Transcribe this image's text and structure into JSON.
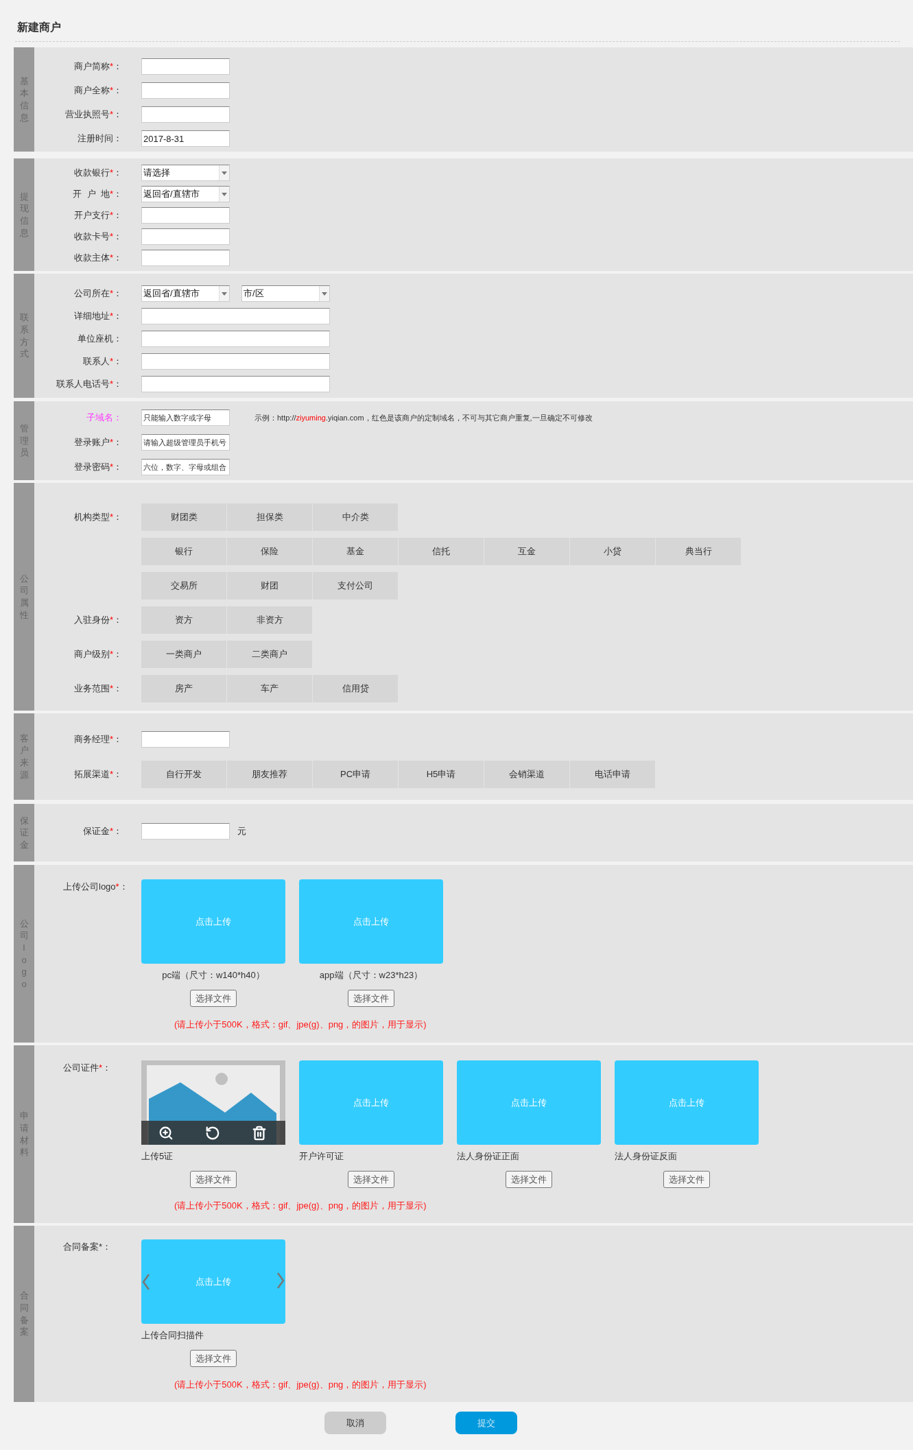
{
  "page": {
    "title": "新建商户"
  },
  "sections": [
    {
      "title": "基本信息",
      "rows": [
        {
          "kind": "input",
          "label": "商户简称",
          "star": "*",
          "colon": "："
        },
        {
          "kind": "input",
          "label": "商户全称",
          "star": "*",
          "colon": "："
        },
        {
          "kind": "input",
          "label": "营业执照号",
          "star": "*",
          "colon": "："
        },
        {
          "kind": "input",
          "label": "注册时间",
          "colon": "：",
          "value": "2017-8-31"
        }
      ]
    },
    {
      "title": "提现信息",
      "rows": [
        {
          "kind": "select",
          "label": "收款银行",
          "star": "*",
          "colon": "：",
          "value": "请选择"
        },
        {
          "kind": "select",
          "label": "开  户  地",
          "star": "*",
          "colon": "：",
          "value": "返回省/直辖市"
        },
        {
          "kind": "input",
          "label": "开户支行",
          "star": "*",
          "colon": "："
        },
        {
          "kind": "input",
          "label": "收款卡号",
          "star": "*",
          "colon": "："
        },
        {
          "kind": "input",
          "label": "收款主体",
          "star": "*",
          "colon": "："
        }
      ]
    },
    {
      "title": "联系方式",
      "rows": [
        {
          "kind": "select_pair",
          "label": "公司所在",
          "star": "*",
          "colon": "：",
          "selects": [
            {
              "value": "返回省/直辖市"
            },
            {
              "value": "市/区"
            }
          ]
        },
        {
          "kind": "long_input",
          "label": "详细地址",
          "star": "*",
          "colon": "："
        },
        {
          "kind": "long_input",
          "label": "单位座机",
          "colon": "："
        },
        {
          "kind": "long_input",
          "label": "联系人",
          "star": "*",
          "colon": "："
        },
        {
          "kind": "long_input",
          "label": "联系人电话号",
          "star": "*",
          "colon": "："
        }
      ]
    },
    {
      "title": "管理员",
      "rows": [
        {
          "kind": "input",
          "label": "子域名",
          "color": "#ff33ff",
          "colon": "：",
          "placeholder": "只能输入数字或字母",
          "hint": {
            "prefix": "示例：http://",
            "highlight": "ziyuming",
            "suffix": ".yiqian.com，红色是该商户的定制域名，不可与其它商户重复,一旦确定不可修改"
          }
        },
        {
          "kind": "input",
          "label": "登录账户",
          "star": "*",
          "colon": "：",
          "placeholder": "请输入超级管理员手机号"
        },
        {
          "kind": "input",
          "label": "登录密码",
          "star": "*",
          "colon": "：",
          "placeholder": "六位，数字、字母或组合"
        }
      ]
    },
    {
      "title": "公司属性",
      "rows": [
        {
          "kind": "options",
          "label": "机构类型",
          "star": "*",
          "colon": "：",
          "option_rows": [
            [
              {
                "label": "财团类",
                "selected": false
              },
              {
                "label": "担保类",
                "selected": false
              },
              {
                "label": "中介类",
                "selected": false
              }
            ],
            [
              {
                "label": "银行",
                "selected": false
              },
              {
                "label": "保险",
                "selected": false
              },
              {
                "label": "基金",
                "selected": false
              },
              {
                "label": "信托",
                "selected": false
              },
              {
                "label": "互金",
                "selected": false
              },
              {
                "label": "小贷",
                "selected": false
              },
              {
                "label": "典当行",
                "selected": false
              }
            ],
            [
              {
                "label": "交易所",
                "selected": false
              },
              {
                "label": "财团",
                "selected": false
              },
              {
                "label": "支付公司",
                "selected": false
              }
            ]
          ]
        },
        {
          "kind": "options",
          "label": "入驻身份",
          "star": "*",
          "colon": "：",
          "option_rows": [
            [
              {
                "label": "资方",
                "selected": false
              },
              {
                "label": "非资方",
                "selected": false
              }
            ]
          ]
        },
        {
          "kind": "options",
          "label": "商户级别",
          "star": "*",
          "colon": "：",
          "option_rows": [
            [
              {
                "label": "一类商户",
                "selected": false
              },
              {
                "label": "二类商户",
                "selected": false
              }
            ]
          ]
        },
        {
          "kind": "options",
          "label": "业务范围",
          "star": "*",
          "colon": "：",
          "option_rows": [
            [
              {
                "label": "房产",
                "selected": false
              },
              {
                "label": "车产",
                "selected": false
              },
              {
                "label": "信用贷",
                "selected": false
              }
            ]
          ]
        }
      ]
    },
    {
      "title": "客户来源",
      "rows": [
        {
          "kind": "input",
          "label": "商务经理",
          "star": "*",
          "colon": "："
        },
        {
          "kind": "options",
          "label": "拓展渠道",
          "star": "*",
          "colon": "：",
          "option_rows": [
            [
              {
                "label": "自行开发",
                "selected": false
              },
              {
                "label": "朋友推荐",
                "selected": false
              },
              {
                "label": "PC申请",
                "selected": false
              },
              {
                "label": "H5申请",
                "selected": false
              },
              {
                "label": "会销渠道",
                "selected": false
              },
              {
                "label": "电话申请",
                "selected": false
              }
            ]
          ]
        }
      ]
    },
    {
      "title": "保证金",
      "rows": [
        {
          "kind": "input",
          "label": "保证金",
          "star": "*",
          "colon": "：",
          "unit": "元"
        }
      ]
    },
    {
      "title": "公司logo",
      "rows": [
        {
          "kind": "upload",
          "label": "上传公司logo",
          "star": "*",
          "colon": "：",
          "items": [
            {
              "kind": "logo",
              "prompt": "点击上传",
              "caption": "pc端（尺寸：w140*h40）",
              "file_button": "选择文件"
            },
            {
              "kind": "logo",
              "prompt": "点击上传",
              "caption": "app端（尺寸：w23*h23）",
              "file_button": "选择文件"
            }
          ],
          "note": "(请上传小于500K，格式：gif、jpe(g)、png，的图片，用于显示)"
        }
      ]
    },
    {
      "title": "申请材料",
      "rows": [
        {
          "kind": "upload",
          "label": "公司证件",
          "star": "*",
          "colon": "：",
          "items": [
            {
              "kind": "preview",
              "caption": "上传5证",
              "file_button": "选择文件"
            },
            {
              "kind": "box",
              "prompt": "点击上传",
              "caption": "开户许可证",
              "file_button": "选择文件"
            },
            {
              "kind": "box",
              "prompt": "点击上传",
              "caption": "法人身份证正面",
              "file_button": "选择文件"
            },
            {
              "kind": "box",
              "prompt": "点击上传",
              "caption": "法人身份证反面",
              "file_button": "选择文件"
            }
          ],
          "note": "(请上传小于500K，格式：gif、jpe(g)、png，的图片，用于显示)"
        }
      ]
    },
    {
      "title": "合同备案",
      "rows": [
        {
          "kind": "upload",
          "label": "合同备案*",
          "colon": "：",
          "items": [
            {
              "kind": "carousel",
              "prompt": "点击上传",
              "caption": "上传合同扫描件",
              "file_button": "选择文件"
            }
          ],
          "note": "(请上传小于500K，格式：gif、jpe(g)、png，的图片，用于显示)"
        }
      ]
    }
  ],
  "actions": [
    {
      "kind": "cancel",
      "label": "取消"
    },
    {
      "kind": "submit",
      "label": "提交"
    }
  ]
}
